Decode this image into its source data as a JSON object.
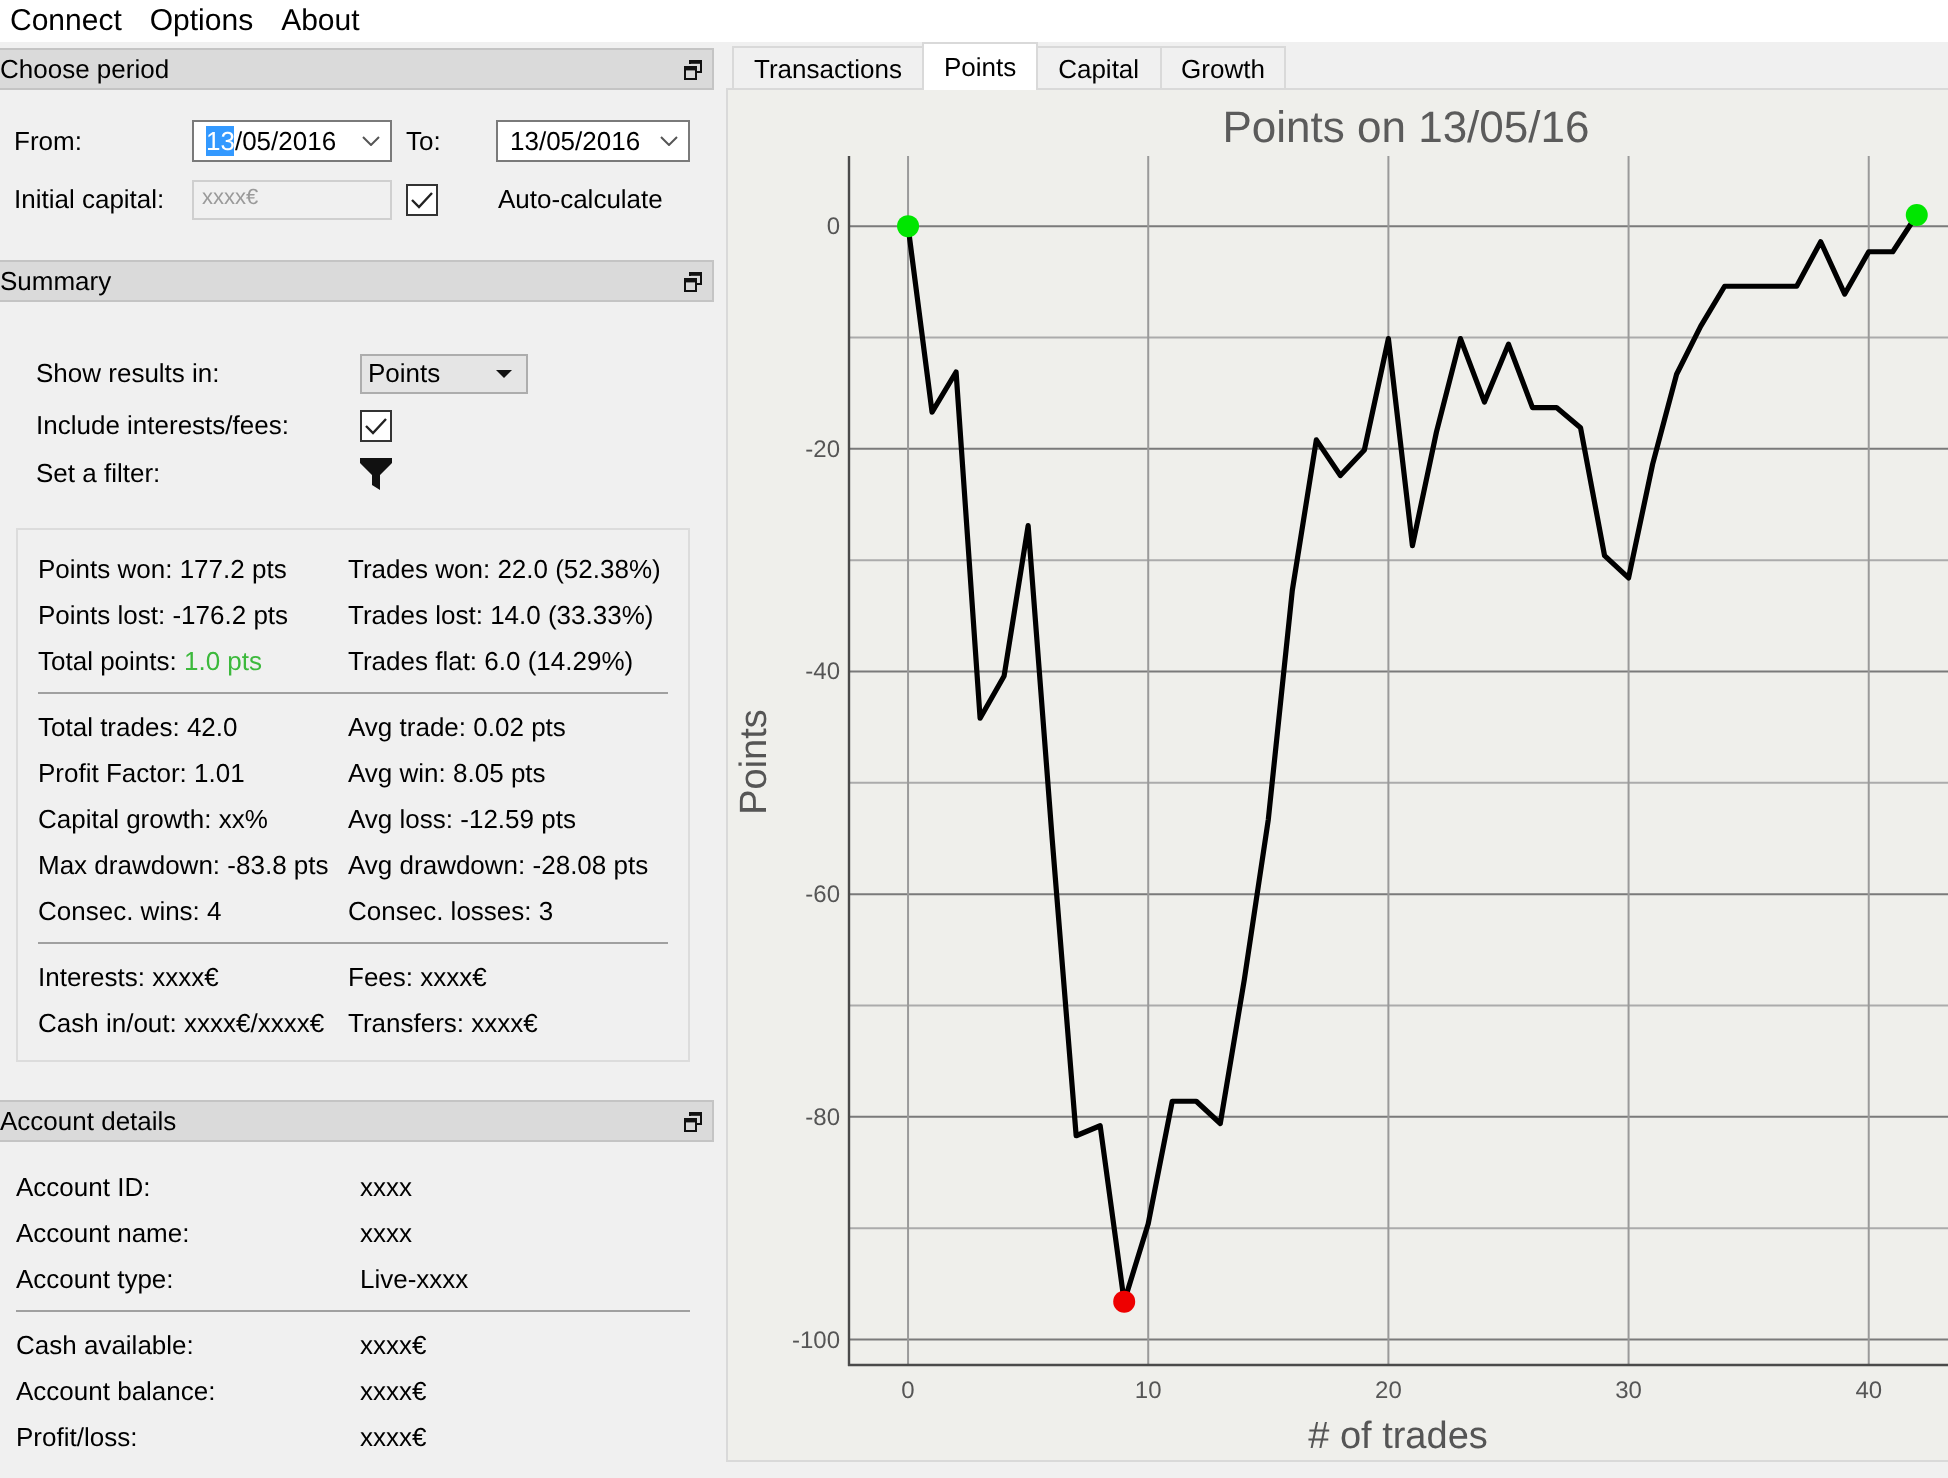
{
  "menu": [
    {
      "label": "Connect"
    },
    {
      "label": "Options"
    },
    {
      "label": "About"
    }
  ],
  "choose_period": {
    "title": "Choose period",
    "from_label": "From:",
    "from_date": {
      "value": "13/05/2016",
      "focused": true
    },
    "to_label": "To:",
    "to_date": {
      "value": "13/05/2016",
      "focused": false
    },
    "initial_capital_label": "Initial capital:",
    "initial_capital": {
      "value": "xxxx€",
      "disabled": true
    },
    "auto_calculate": {
      "label": "Auto-calculate",
      "checked": true
    }
  },
  "summary": {
    "title": "Summary",
    "show_results_label": "Show results in:",
    "show_results_value": "Points",
    "include_label": "Include interests/fees:",
    "include_checked": true,
    "filter_label": "Set a filter:",
    "stat_groups": [
      [
        [
          {
            "label": "Points won:",
            "value": "177.2 pts"
          },
          {
            "label": "Trades won:",
            "value": "22.0 (52.38%)"
          }
        ],
        [
          {
            "label": "Points lost:",
            "value": "-176.2 pts"
          },
          {
            "label": "Trades lost:",
            "value": "14.0 (33.33%)"
          }
        ],
        [
          {
            "label": "Total points:",
            "value": "1.0 pts",
            "color": "#3cb93c"
          },
          {
            "label": "Trades flat:",
            "value": "6.0 (14.29%)"
          }
        ]
      ],
      [
        [
          {
            "label": "Total trades:",
            "value": "42.0"
          },
          {
            "label": "Avg trade:",
            "value": "0.02 pts"
          }
        ],
        [
          {
            "label": "Profit Factor:",
            "value": "1.01"
          },
          {
            "label": "Avg win:",
            "value": "8.05 pts"
          }
        ],
        [
          {
            "label": "Capital growth:",
            "value": "xx%"
          },
          {
            "label": "Avg loss:",
            "value": "-12.59 pts"
          }
        ],
        [
          {
            "label": "Max drawdown:",
            "value": "-83.8 pts"
          },
          {
            "label": "Avg drawdown:",
            "value": "-28.08 pts"
          }
        ],
        [
          {
            "label": "Consec. wins:",
            "value": "4"
          },
          {
            "label": "Consec. losses:",
            "value": "3"
          }
        ]
      ],
      [
        [
          {
            "label": "Interests:",
            "value": "xxxx€"
          },
          {
            "label": "Fees:",
            "value": "xxxx€"
          }
        ],
        [
          {
            "label": "Cash in/out:",
            "value": "xxxx€/xxxx€"
          },
          {
            "label": "Transfers:",
            "value": "xxxx€"
          }
        ]
      ]
    ]
  },
  "account_details": {
    "title": "Account details",
    "groups": [
      [
        {
          "label": "Account ID:",
          "value": "xxxx"
        },
        {
          "label": "Account name:",
          "value": "xxxx"
        },
        {
          "label": "Account type:",
          "value": "Live-xxxx"
        }
      ],
      [
        {
          "label": "Cash available:",
          "value": "xxxx€"
        },
        {
          "label": "Account balance:",
          "value": "xxxx€"
        },
        {
          "label": "Profit/loss:",
          "value": "xxxx€"
        }
      ]
    ]
  },
  "tabs": [
    {
      "label": "Transactions",
      "selected": false
    },
    {
      "label": "Points",
      "selected": true
    },
    {
      "label": "Capital",
      "selected": false
    },
    {
      "label": "Growth",
      "selected": false
    }
  ],
  "chart": {
    "chart_data": {
      "type": "line",
      "title": "Points on 13/05/16",
      "xlabel": "# of trades",
      "ylabel": "Points",
      "x": [
        0,
        1,
        2,
        3,
        4,
        5,
        6,
        7,
        8,
        9,
        10,
        11,
        12,
        13,
        14,
        15,
        16,
        17,
        18,
        19,
        20,
        21,
        22,
        23,
        24,
        25,
        26,
        27,
        28,
        29,
        30,
        31,
        32,
        33,
        34,
        35,
        36,
        37,
        38,
        39,
        40,
        41,
        42
      ],
      "series": [
        {
          "color": "#000000",
          "values": [
            0,
            -16.7,
            -13.1,
            -44.2,
            -40.4,
            -26.9,
            -55,
            -81.7,
            -80.8,
            -96.6,
            -89.6,
            -78.6,
            -78.6,
            -80.6,
            -67.7,
            -53.3,
            -32.7,
            -19.2,
            -22.4,
            -20.1,
            -10.1,
            -28.7,
            -18.5,
            -10.1,
            -15.8,
            -10.6,
            -16.3,
            -16.3,
            -18.1,
            -29.6,
            -31.6,
            -21.4,
            -13.3,
            -9,
            -5.4,
            -5.4,
            -5.4,
            -5.4,
            -1.4,
            -6.1,
            -2.3,
            -2.3,
            1.0
          ]
        }
      ],
      "xlim": [
        -2.5,
        43.3
      ],
      "ylim": [
        -102.2,
        6.3
      ],
      "xticks": [
        0,
        10,
        20,
        30,
        40
      ],
      "yticks": [
        0,
        -20,
        -40,
        -60,
        -80,
        -100
      ],
      "grid": true
    },
    "markers": [
      {
        "kind": "start",
        "color": "#00e600"
      },
      {
        "kind": "minimum",
        "color": "#ee0000"
      },
      {
        "kind": "end",
        "color": "#00e600"
      }
    ]
  }
}
